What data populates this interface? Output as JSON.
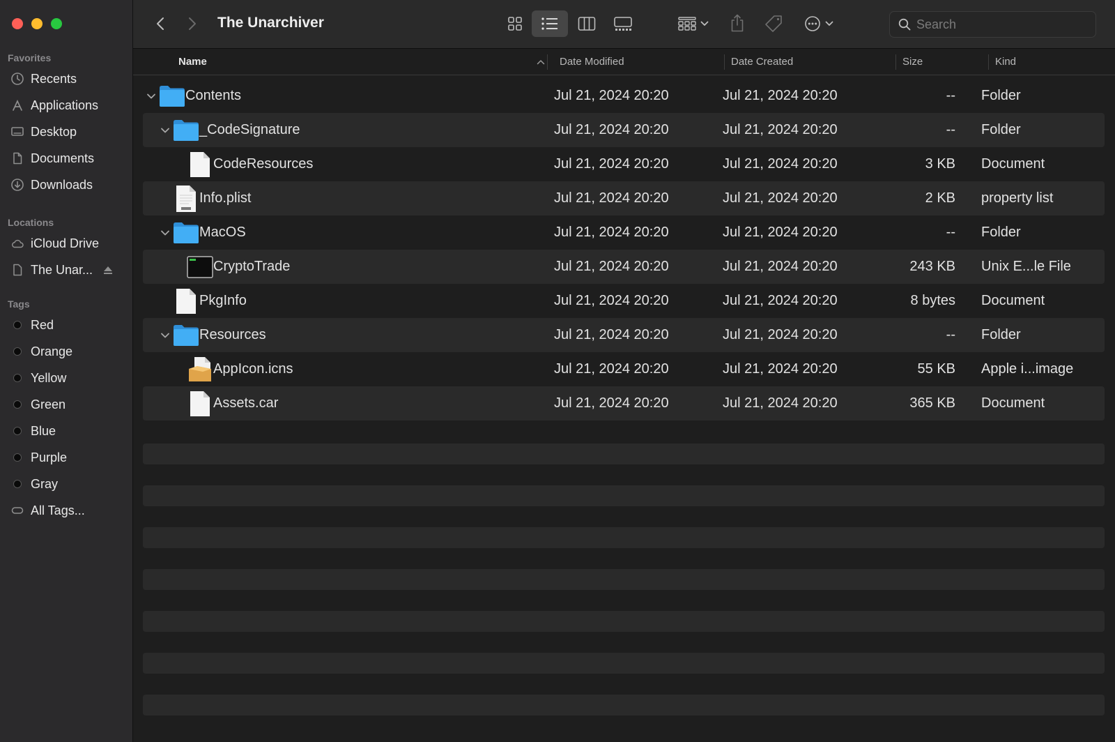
{
  "window": {
    "title": "The Unarchiver"
  },
  "sidebar": {
    "favorites_header": "Favorites",
    "favorites": [
      {
        "label": "Recents",
        "icon": "clock-icon"
      },
      {
        "label": "Applications",
        "icon": "applications-icon"
      },
      {
        "label": "Desktop",
        "icon": "desktop-icon"
      },
      {
        "label": "Documents",
        "icon": "document-icon"
      },
      {
        "label": "Downloads",
        "icon": "download-icon"
      }
    ],
    "locations_header": "Locations",
    "locations": [
      {
        "label": "iCloud Drive",
        "icon": "cloud-icon"
      },
      {
        "label": "The Unar...",
        "icon": "disk-icon",
        "ejectable": true
      }
    ],
    "tags_header": "Tags",
    "tags": [
      {
        "label": "Red"
      },
      {
        "label": "Orange"
      },
      {
        "label": "Yellow"
      },
      {
        "label": "Green"
      },
      {
        "label": "Blue"
      },
      {
        "label": "Purple"
      },
      {
        "label": "Gray"
      }
    ],
    "all_tags": "All Tags..."
  },
  "toolbar": {
    "search_placeholder": "Search",
    "active_view": "list"
  },
  "columns": {
    "name": "Name",
    "date_modified": "Date Modified",
    "date_created": "Date Created",
    "size": "Size",
    "kind": "Kind",
    "sort": "name-ascending"
  },
  "files": [
    {
      "name": "Contents",
      "modified": "Jul 21, 2024 20:20",
      "created": "Jul 21, 2024 20:20",
      "size": "--",
      "kind": "Folder",
      "icon": "folder-icon",
      "depth": 0,
      "expanded": true
    },
    {
      "name": "_CodeSignature",
      "modified": "Jul 21, 2024 20:20",
      "created": "Jul 21, 2024 20:20",
      "size": "--",
      "kind": "Folder",
      "icon": "folder-icon",
      "depth": 1,
      "expanded": true
    },
    {
      "name": "CodeResources",
      "modified": "Jul 21, 2024 20:20",
      "created": "Jul 21, 2024 20:20",
      "size": "3 KB",
      "kind": "Document",
      "icon": "document-file-icon",
      "depth": 2
    },
    {
      "name": "Info.plist",
      "modified": "Jul 21, 2024 20:20",
      "created": "Jul 21, 2024 20:20",
      "size": "2 KB",
      "kind": "property list",
      "icon": "plist-file-icon",
      "depth": 1
    },
    {
      "name": "MacOS",
      "modified": "Jul 21, 2024 20:20",
      "created": "Jul 21, 2024 20:20",
      "size": "--",
      "kind": "Folder",
      "icon": "folder-icon",
      "depth": 1,
      "expanded": true
    },
    {
      "name": "CryptoTrade",
      "modified": "Jul 21, 2024 20:20",
      "created": "Jul 21, 2024 20:20",
      "size": "243 KB",
      "kind": "Unix E...le File",
      "icon": "executable-icon",
      "depth": 2
    },
    {
      "name": "PkgInfo",
      "modified": "Jul 21, 2024 20:20",
      "created": "Jul 21, 2024 20:20",
      "size": "8 bytes",
      "kind": "Document",
      "icon": "document-file-icon",
      "depth": 1
    },
    {
      "name": "Resources",
      "modified": "Jul 21, 2024 20:20",
      "created": "Jul 21, 2024 20:20",
      "size": "--",
      "kind": "Folder",
      "icon": "folder-icon",
      "depth": 1,
      "expanded": true
    },
    {
      "name": "AppIcon.icns",
      "modified": "Jul 21, 2024 20:20",
      "created": "Jul 21, 2024 20:20",
      "size": "55 KB",
      "kind": "Apple i...image",
      "icon": "icns-file-icon",
      "depth": 2
    },
    {
      "name": "Assets.car",
      "modified": "Jul 21, 2024 20:20",
      "created": "Jul 21, 2024 20:20",
      "size": "365 KB",
      "kind": "Document",
      "icon": "document-file-icon",
      "depth": 2
    }
  ],
  "colors": {
    "folder": "#3aa6f0",
    "accent": "#0a84ff"
  }
}
